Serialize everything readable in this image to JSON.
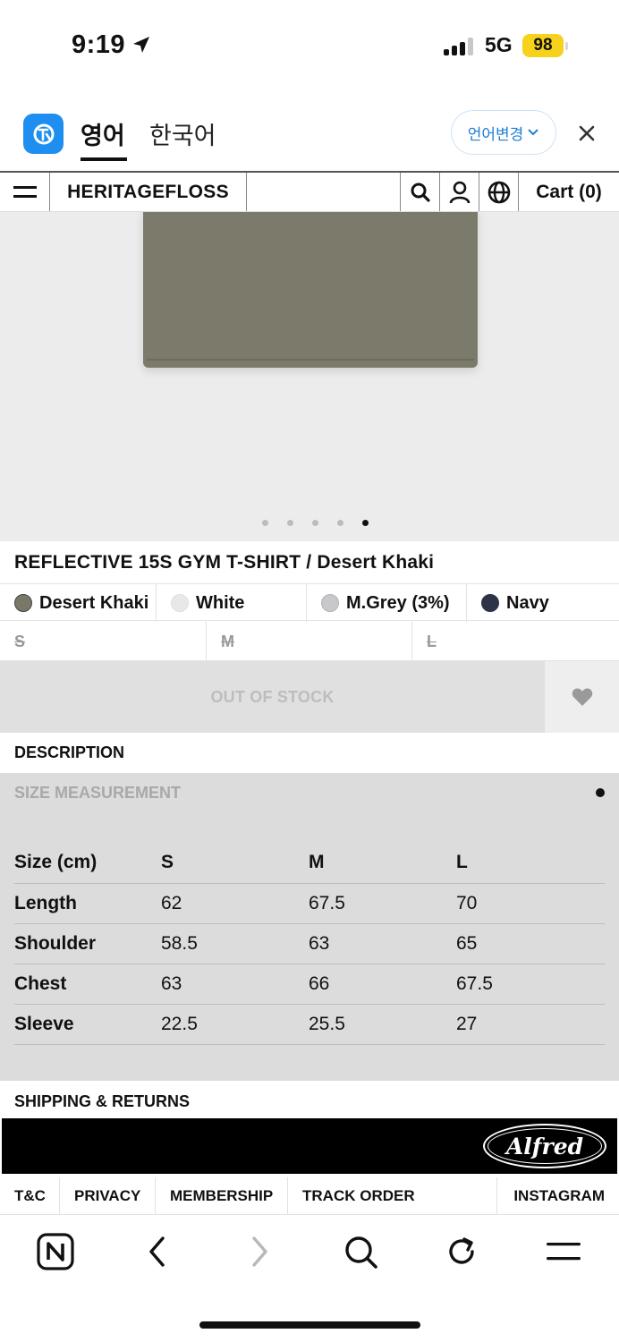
{
  "status_bar": {
    "time": "9:19",
    "network": "5G",
    "battery": "98"
  },
  "translate_bar": {
    "tab_english": "영어",
    "tab_korean": "한국어",
    "change_language": "언어변경"
  },
  "site_header": {
    "brand": "HERITAGEFLOSS",
    "cart": "Cart (0)"
  },
  "carousel": {
    "total_slides": 5,
    "active_slide": 5
  },
  "product": {
    "title": "REFLECTIVE 15S GYM T-SHIRT / Desert Khaki",
    "colors": [
      {
        "label": "Desert Khaki",
        "swatch": "#7a7868",
        "selected": true
      },
      {
        "label": "White",
        "swatch": "#e8e8e8",
        "selected": false
      },
      {
        "label": "M.Grey (3%)",
        "swatch": "#c7c7cc",
        "selected": false
      },
      {
        "label": "Navy",
        "swatch": "#2e3348",
        "selected": false
      }
    ],
    "sizes": [
      "S",
      "M",
      "L"
    ],
    "button": "OUT OF STOCK"
  },
  "description_heading": "DESCRIPTION",
  "size_measurement": {
    "heading": "SIZE MEASUREMENT",
    "columns": [
      "Size (cm)",
      "S",
      "M",
      "L"
    ],
    "rows": [
      [
        "Length",
        "62",
        "67.5",
        "70"
      ],
      [
        "Shoulder",
        "58.5",
        "63",
        "65"
      ],
      [
        "Chest",
        "63",
        "66",
        "67.5"
      ],
      [
        "Sleeve",
        "22.5",
        "25.5",
        "27"
      ]
    ]
  },
  "shipping_heading": "SHIPPING & RETURNS",
  "banner": {
    "logo_text": "Alfred"
  },
  "footer": {
    "links": [
      "T&C",
      "PRIVACY",
      "MEMBERSHIP",
      "TRACK ORDER",
      "INSTAGRAM"
    ]
  },
  "icons": [
    "location-arrow-icon",
    "naver-translate-icon",
    "chevron-down-icon",
    "close-icon",
    "hamburger-menu-icon",
    "search-icon",
    "user-icon",
    "globe-icon",
    "heart-icon",
    "naver-home-icon",
    "back-icon",
    "forward-icon",
    "reload-icon"
  ]
}
